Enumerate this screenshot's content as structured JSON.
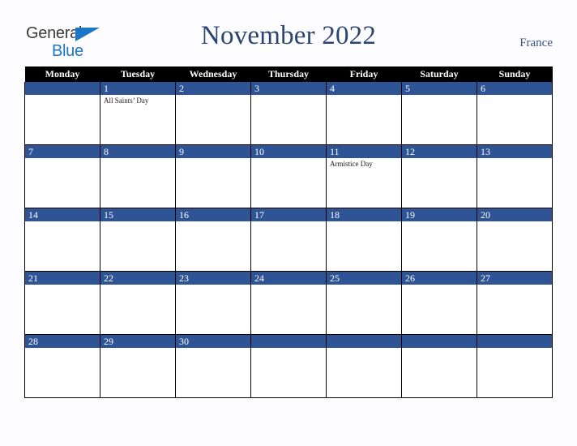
{
  "brand": {
    "name_part1": "General",
    "name_part2": "Blue",
    "triangle_color": "#1c76c7",
    "text_color": "#3b3b3b"
  },
  "header": {
    "title": "November 2022",
    "country": "France",
    "title_color": "#2c4570"
  },
  "calendar": {
    "accent_color": "#2e5496",
    "header_bg": "#000000",
    "weekday_headers": [
      "Monday",
      "Tuesday",
      "Wednesday",
      "Thursday",
      "Friday",
      "Saturday",
      "Sunday"
    ],
    "weeks": [
      [
        {
          "day": "",
          "event": ""
        },
        {
          "day": "1",
          "event": "All Saints’ Day"
        },
        {
          "day": "2",
          "event": ""
        },
        {
          "day": "3",
          "event": ""
        },
        {
          "day": "4",
          "event": ""
        },
        {
          "day": "5",
          "event": ""
        },
        {
          "day": "6",
          "event": ""
        }
      ],
      [
        {
          "day": "7",
          "event": ""
        },
        {
          "day": "8",
          "event": ""
        },
        {
          "day": "9",
          "event": ""
        },
        {
          "day": "10",
          "event": ""
        },
        {
          "day": "11",
          "event": "Armistice Day"
        },
        {
          "day": "12",
          "event": ""
        },
        {
          "day": "13",
          "event": ""
        }
      ],
      [
        {
          "day": "14",
          "event": ""
        },
        {
          "day": "15",
          "event": ""
        },
        {
          "day": "16",
          "event": ""
        },
        {
          "day": "17",
          "event": ""
        },
        {
          "day": "18",
          "event": ""
        },
        {
          "day": "19",
          "event": ""
        },
        {
          "day": "20",
          "event": ""
        }
      ],
      [
        {
          "day": "21",
          "event": ""
        },
        {
          "day": "22",
          "event": ""
        },
        {
          "day": "23",
          "event": ""
        },
        {
          "day": "24",
          "event": ""
        },
        {
          "day": "25",
          "event": ""
        },
        {
          "day": "26",
          "event": ""
        },
        {
          "day": "27",
          "event": ""
        }
      ],
      [
        {
          "day": "28",
          "event": ""
        },
        {
          "day": "29",
          "event": ""
        },
        {
          "day": "30",
          "event": ""
        },
        {
          "day": "",
          "event": ""
        },
        {
          "day": "",
          "event": ""
        },
        {
          "day": "",
          "event": ""
        },
        {
          "day": "",
          "event": ""
        }
      ]
    ]
  }
}
